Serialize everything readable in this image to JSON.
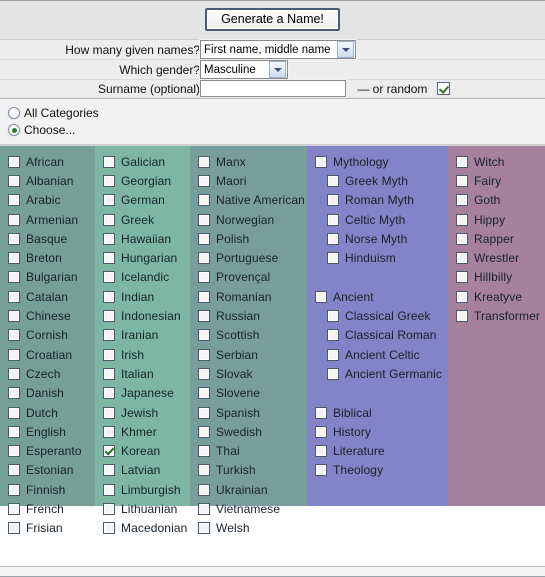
{
  "toolbar": {
    "generate_label": "Generate a Name!"
  },
  "form": {
    "rows": [
      {
        "label": "How many given names?",
        "value": "First name, middle name"
      },
      {
        "label": "Which gender?",
        "value": "Masculine"
      },
      {
        "label": "Surname (optional)",
        "value": "",
        "placeholder": ""
      }
    ],
    "random_dash": "— or random",
    "random_checked": true
  },
  "category_mode": {
    "options": [
      {
        "label": "All Categories",
        "selected": false
      },
      {
        "label": "Choose...",
        "selected": true
      }
    ]
  },
  "columns": [
    {
      "name": "languages-a-f",
      "color": "#76a096",
      "items": [
        {
          "label": "African",
          "checked": false,
          "indent": false
        },
        {
          "label": "Albanian",
          "checked": false,
          "indent": false
        },
        {
          "label": "Arabic",
          "checked": false,
          "indent": false
        },
        {
          "label": "Armenian",
          "checked": false,
          "indent": false
        },
        {
          "label": "Basque",
          "checked": false,
          "indent": false
        },
        {
          "label": "Breton",
          "checked": false,
          "indent": false
        },
        {
          "label": "Bulgarian",
          "checked": false,
          "indent": false
        },
        {
          "label": "Catalan",
          "checked": false,
          "indent": false
        },
        {
          "label": "Chinese",
          "checked": false,
          "indent": false
        },
        {
          "label": "Cornish",
          "checked": false,
          "indent": false
        },
        {
          "label": "Croatian",
          "checked": false,
          "indent": false
        },
        {
          "label": "Czech",
          "checked": false,
          "indent": false
        },
        {
          "label": "Danish",
          "checked": false,
          "indent": false
        },
        {
          "label": "Dutch",
          "checked": false,
          "indent": false
        },
        {
          "label": "English",
          "checked": false,
          "indent": false
        },
        {
          "label": "Esperanto",
          "checked": false,
          "indent": false
        },
        {
          "label": "Estonian",
          "checked": false,
          "indent": false
        },
        {
          "label": "Finnish",
          "checked": false,
          "indent": false
        },
        {
          "label": "French",
          "checked": false,
          "indent": false
        },
        {
          "label": "Frisian",
          "checked": false,
          "indent": false
        }
      ]
    },
    {
      "name": "languages-g-m",
      "color": "#7db7a3",
      "items": [
        {
          "label": "Galician",
          "checked": false,
          "indent": false
        },
        {
          "label": "Georgian",
          "checked": false,
          "indent": false
        },
        {
          "label": "German",
          "checked": false,
          "indent": false
        },
        {
          "label": "Greek",
          "checked": false,
          "indent": false
        },
        {
          "label": "Hawaiian",
          "checked": false,
          "indent": false
        },
        {
          "label": "Hungarian",
          "checked": false,
          "indent": false
        },
        {
          "label": "Icelandic",
          "checked": false,
          "indent": false
        },
        {
          "label": "Indian",
          "checked": false,
          "indent": false
        },
        {
          "label": "Indonesian",
          "checked": false,
          "indent": false
        },
        {
          "label": "Iranian",
          "checked": false,
          "indent": false
        },
        {
          "label": "Irish",
          "checked": false,
          "indent": false
        },
        {
          "label": "Italian",
          "checked": false,
          "indent": false
        },
        {
          "label": "Japanese",
          "checked": false,
          "indent": false
        },
        {
          "label": "Jewish",
          "checked": false,
          "indent": false
        },
        {
          "label": "Khmer",
          "checked": false,
          "indent": false
        },
        {
          "label": "Korean",
          "checked": true,
          "indent": false
        },
        {
          "label": "Latvian",
          "checked": false,
          "indent": false
        },
        {
          "label": "Limburgish",
          "checked": false,
          "indent": false
        },
        {
          "label": "Lithuanian",
          "checked": false,
          "indent": false
        },
        {
          "label": "Macedonian",
          "checked": false,
          "indent": false
        }
      ]
    },
    {
      "name": "languages-m-w",
      "color": "#779e9d",
      "items": [
        {
          "label": "Manx",
          "checked": false,
          "indent": false
        },
        {
          "label": "Maori",
          "checked": false,
          "indent": false
        },
        {
          "label": "Native American",
          "checked": false,
          "indent": false
        },
        {
          "label": "Norwegian",
          "checked": false,
          "indent": false
        },
        {
          "label": "Polish",
          "checked": false,
          "indent": false
        },
        {
          "label": "Portuguese",
          "checked": false,
          "indent": false
        },
        {
          "label": "Provençal",
          "checked": false,
          "indent": false
        },
        {
          "label": "Romanian",
          "checked": false,
          "indent": false
        },
        {
          "label": "Russian",
          "checked": false,
          "indent": false
        },
        {
          "label": "Scottish",
          "checked": false,
          "indent": false
        },
        {
          "label": "Serbian",
          "checked": false,
          "indent": false
        },
        {
          "label": "Slovak",
          "checked": false,
          "indent": false
        },
        {
          "label": "Slovene",
          "checked": false,
          "indent": false
        },
        {
          "label": "Spanish",
          "checked": false,
          "indent": false
        },
        {
          "label": "Swedish",
          "checked": false,
          "indent": false
        },
        {
          "label": "Thai",
          "checked": false,
          "indent": false
        },
        {
          "label": "Turkish",
          "checked": false,
          "indent": false
        },
        {
          "label": "Ukrainian",
          "checked": false,
          "indent": false
        },
        {
          "label": "Vietnamese",
          "checked": false,
          "indent": false
        },
        {
          "label": "Welsh",
          "checked": false,
          "indent": false
        }
      ]
    },
    {
      "name": "mythology-ancient",
      "color": "#8184c6",
      "items": [
        {
          "label": "Mythology",
          "checked": false,
          "indent": false
        },
        {
          "label": "Greek Myth",
          "checked": false,
          "indent": true
        },
        {
          "label": "Roman Myth",
          "checked": false,
          "indent": true
        },
        {
          "label": "Celtic Myth",
          "checked": false,
          "indent": true
        },
        {
          "label": "Norse Myth",
          "checked": false,
          "indent": true
        },
        {
          "label": "Hinduism",
          "checked": false,
          "indent": true
        },
        {
          "spacer": true
        },
        {
          "label": "Ancient",
          "checked": false,
          "indent": false
        },
        {
          "label": "Classical Greek",
          "checked": false,
          "indent": true
        },
        {
          "label": "Classical Roman",
          "checked": false,
          "indent": true
        },
        {
          "label": "Ancient Celtic",
          "checked": false,
          "indent": true
        },
        {
          "label": "Ancient Germanic",
          "checked": false,
          "indent": true
        },
        {
          "spacer": true
        },
        {
          "label": "Biblical",
          "checked": false,
          "indent": false
        },
        {
          "label": "History",
          "checked": false,
          "indent": false
        },
        {
          "label": "Literature",
          "checked": false,
          "indent": false
        },
        {
          "label": "Theology",
          "checked": false,
          "indent": false
        }
      ]
    },
    {
      "name": "character-types",
      "color": "#a5819e",
      "items": [
        {
          "label": "Witch",
          "checked": false,
          "indent": false
        },
        {
          "label": "Fairy",
          "checked": false,
          "indent": false
        },
        {
          "label": "Goth",
          "checked": false,
          "indent": false
        },
        {
          "label": "Hippy",
          "checked": false,
          "indent": false
        },
        {
          "label": "Rapper",
          "checked": false,
          "indent": false
        },
        {
          "label": "Wrestler",
          "checked": false,
          "indent": false
        },
        {
          "label": "Hillbilly",
          "checked": false,
          "indent": false
        },
        {
          "label": "Kreatyve",
          "checked": false,
          "indent": false
        },
        {
          "label": "Transformer",
          "checked": false,
          "indent": false
        }
      ]
    }
  ]
}
